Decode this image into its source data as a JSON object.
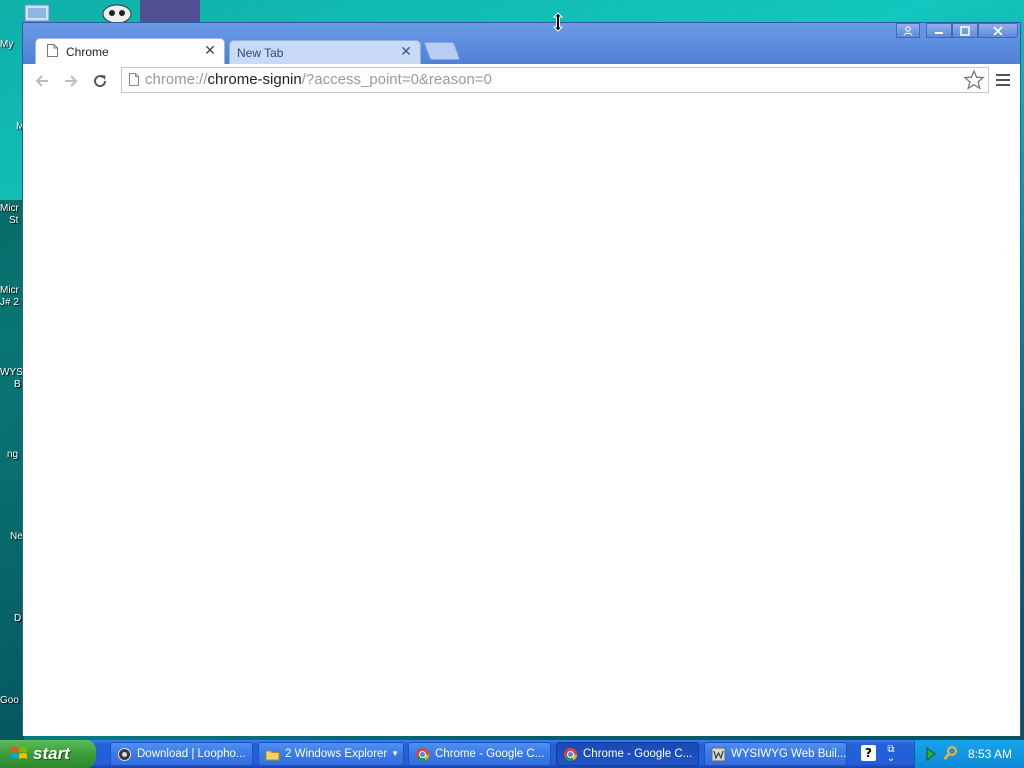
{
  "desktop": {
    "icon_labels": [
      "My",
      "M",
      "Micr",
      "St",
      "Micr",
      "J# 2",
      "WYS",
      "B",
      "ng",
      "Ne",
      "D",
      "Goo"
    ]
  },
  "browser": {
    "tabs": [
      {
        "label": "Chrome",
        "active": true
      },
      {
        "label": "New Tab",
        "active": false
      }
    ],
    "omnibox": {
      "scheme": "chrome://",
      "host": "chrome-signin",
      "path": "/?access_point=0&reason=0"
    }
  },
  "taskbar": {
    "start_label": "start",
    "tasks": [
      {
        "label": "Download | Loopho...",
        "icon": "web-icon"
      },
      {
        "label": "2 Windows Explorer",
        "icon": "folder-icon"
      },
      {
        "label": "Chrome - Google C...",
        "icon": "chrome-icon"
      },
      {
        "label": "Chrome - Google C...",
        "icon": "chrome-icon",
        "active": true
      },
      {
        "label": "WYSIWYG Web Buil...",
        "icon": "wysiwyg-icon"
      }
    ],
    "clock": "8:53 AM"
  },
  "colors": {
    "titlebar": "#4f80d6",
    "taskbar": "#245edb",
    "start_green": "#3b9c39",
    "tray": "#0f8ad5"
  }
}
